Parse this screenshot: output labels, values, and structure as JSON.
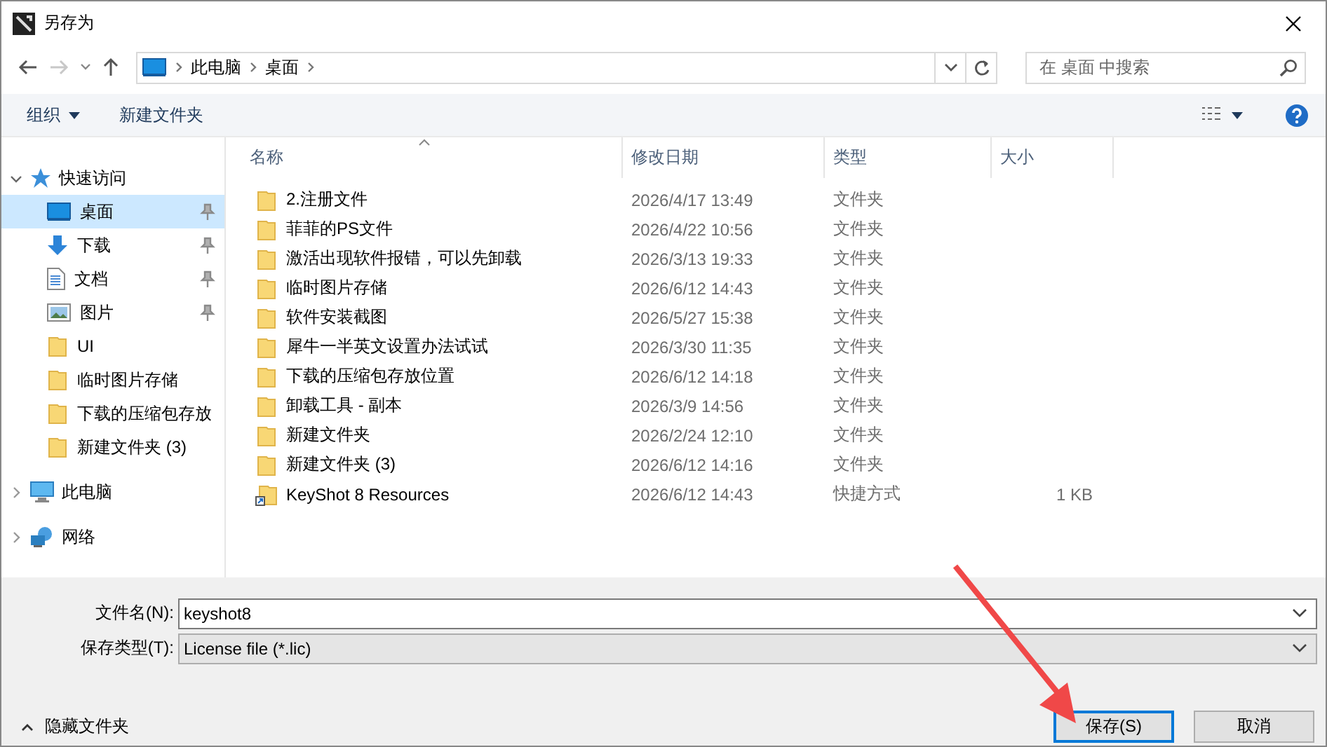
{
  "window": {
    "title": "另存为"
  },
  "address": {
    "path": [
      "此电脑",
      "桌面"
    ]
  },
  "search": {
    "placeholder": "在 桌面 中搜索"
  },
  "toolbar": {
    "organize": "组织",
    "new_folder": "新建文件夹"
  },
  "sidebar": {
    "items": [
      {
        "label": "快速访问",
        "kind": "star",
        "expanded": true,
        "children": [
          {
            "label": "桌面",
            "kind": "desktop",
            "pinned": true,
            "selected": true
          },
          {
            "label": "下载",
            "kind": "download",
            "pinned": true,
            "selected": false
          },
          {
            "label": "文档",
            "kind": "document",
            "pinned": true,
            "selected": false
          },
          {
            "label": "图片",
            "kind": "image",
            "pinned": true,
            "selected": false
          },
          {
            "label": "UI",
            "kind": "folder",
            "pinned": false,
            "selected": false
          },
          {
            "label": "临时图片存储",
            "kind": "folder",
            "pinned": false,
            "selected": false
          },
          {
            "label": "下载的压缩包存放",
            "kind": "folder",
            "pinned": false,
            "selected": false
          },
          {
            "label": "新建文件夹 (3)",
            "kind": "folder",
            "pinned": false,
            "selected": false
          }
        ]
      },
      {
        "label": "此电脑",
        "kind": "computer",
        "expanded": false
      },
      {
        "label": "网络",
        "kind": "network",
        "expanded": false
      }
    ]
  },
  "table": {
    "columns": [
      "名称",
      "修改日期",
      "类型",
      "大小"
    ],
    "rows": [
      {
        "name": "2.注册文件",
        "date": "2026/4/17 13:49",
        "type": "文件夹",
        "kind": "folder"
      },
      {
        "name": "菲菲的PS文件",
        "date": "2026/4/22 10:56",
        "type": "文件夹",
        "kind": "folder"
      },
      {
        "name": "激活出现软件报错，可以先卸载",
        "date": "2026/3/13 19:33",
        "type": "文件夹",
        "kind": "folder"
      },
      {
        "name": "临时图片存储",
        "date": "2026/6/12 14:43",
        "type": "文件夹",
        "kind": "folder"
      },
      {
        "name": "软件安装截图",
        "date": "2026/5/27 15:38",
        "type": "文件夹",
        "kind": "folder"
      },
      {
        "name": "犀牛一半英文设置办法试试",
        "date": "2026/3/30 11:35",
        "type": "文件夹",
        "kind": "folder"
      },
      {
        "name": "下载的压缩包存放位置",
        "date": "2026/6/12 14:18",
        "type": "文件夹",
        "kind": "folder"
      },
      {
        "name": "卸载工具 - 副本",
        "date": "2026/3/9 14:56",
        "type": "文件夹",
        "kind": "folder"
      },
      {
        "name": "新建文件夹",
        "date": "2026/2/24 12:10",
        "type": "文件夹",
        "kind": "folder"
      },
      {
        "name": "新建文件夹 (3)",
        "date": "2026/6/12 14:16",
        "type": "文件夹",
        "kind": "folder"
      },
      {
        "name": "KeyShot 8 Resources",
        "date": "2026/6/12 14:43",
        "type": "快捷方式",
        "size": "1 KB",
        "kind": "shortcut"
      }
    ]
  },
  "form": {
    "filename_label": "文件名(N):",
    "filename": "keyshot8",
    "filetype_label": "保存类型(T):",
    "filetype": "License file (*.lic)"
  },
  "hide_folders": "隐藏文件夹",
  "buttons": [
    {
      "label": "保存(S)",
      "default": true
    },
    {
      "label": "取消",
      "default": false
    }
  ]
}
